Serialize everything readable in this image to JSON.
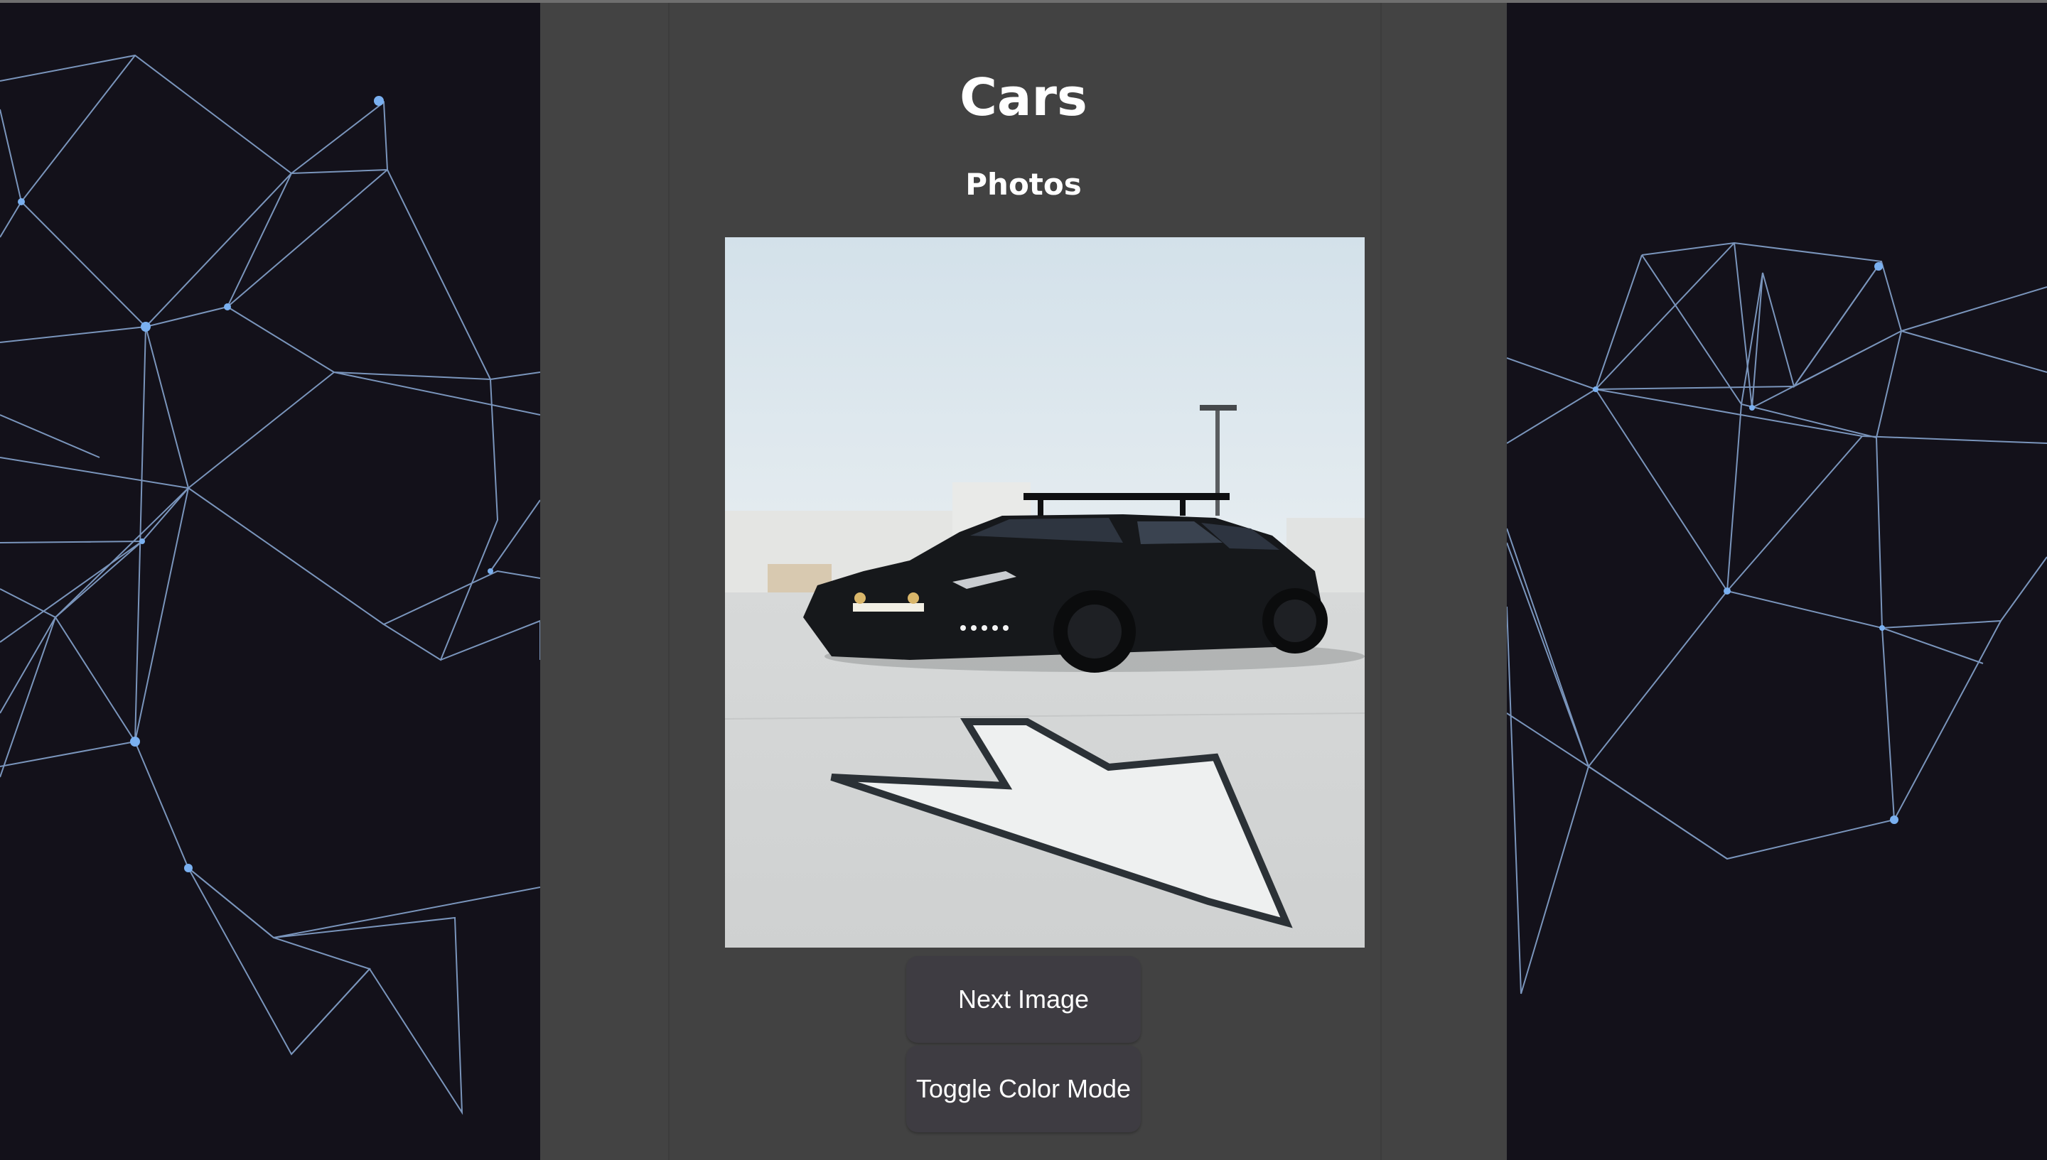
{
  "page": {
    "title": "Cars",
    "subtitle": "Photos"
  },
  "photo": {
    "alt": "Black hatchback car parked on a concrete rooftop lot next to a painted arrow"
  },
  "buttons": {
    "next_label": "Next Image",
    "toggle_label": "Toggle Color Mode"
  },
  "colors": {
    "background": "#13111a",
    "panel": "#434343",
    "network_line": "#9dc2f2",
    "button": "#3e3c42",
    "text": "#ffffff"
  }
}
